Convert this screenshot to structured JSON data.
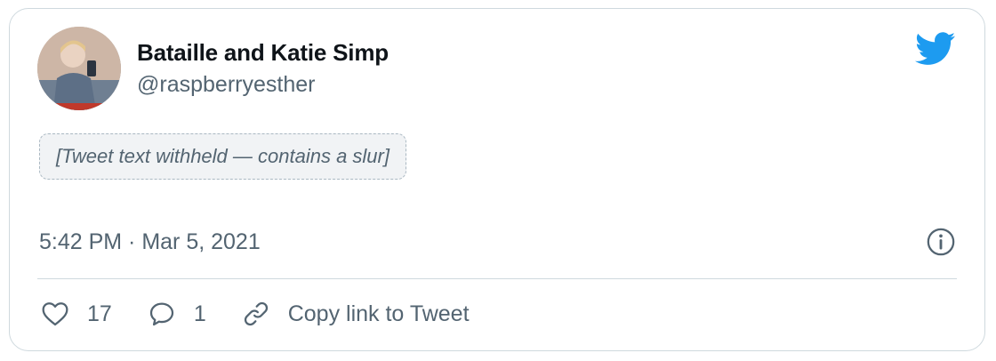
{
  "tweet": {
    "display_name": "Bataille and Katie Simp",
    "handle": "@raspberryesther",
    "body_notice": "[Tweet text withheld — contains a slur]",
    "timestamp": "5:42 PM · Mar 5, 2021"
  },
  "actions": {
    "like_count": "17",
    "reply_count": "1",
    "copy_link_label": "Copy link to Tweet"
  },
  "icons": {
    "brand": "twitter-bird-icon",
    "info": "info-icon",
    "like": "heart-icon",
    "reply": "speech-bubble-icon",
    "link": "link-icon"
  },
  "colors": {
    "brand_blue": "#1d9bf0",
    "secondary_text": "#536471",
    "border": "#cfd9de"
  }
}
